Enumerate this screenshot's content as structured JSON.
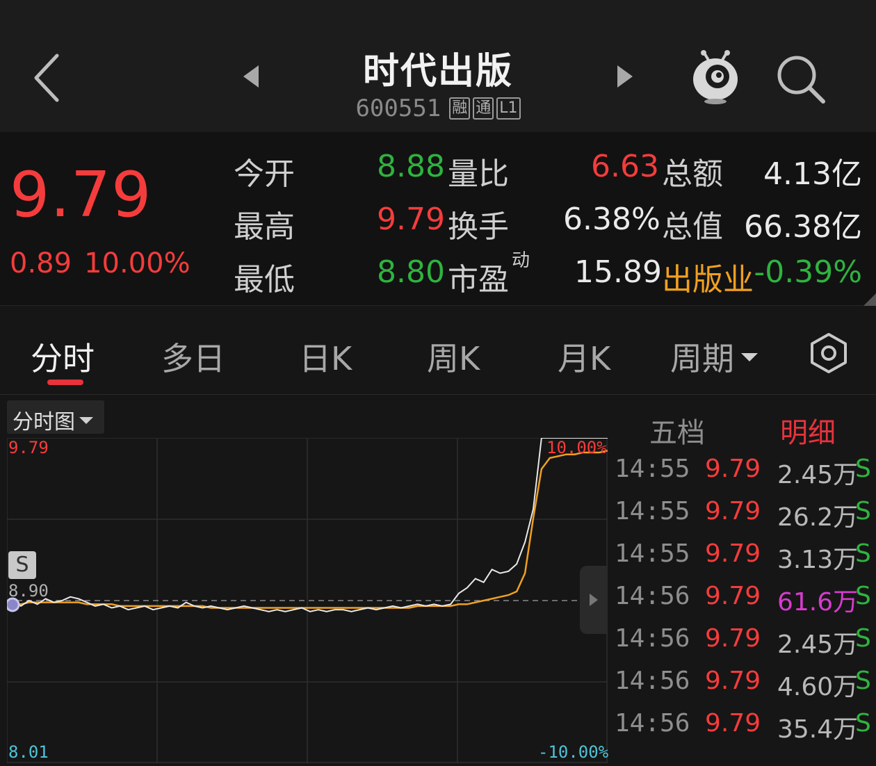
{
  "header": {
    "title": "时代出版",
    "code": "600551",
    "tags": [
      "融",
      "通",
      "L1"
    ]
  },
  "quote": {
    "price": "9.79",
    "change": "0.89",
    "change_pct": "10.00%",
    "rows": [
      {
        "l1": "今开",
        "v1": "8.88",
        "l2": "量比",
        "v2": "6.63",
        "l3": "总额",
        "v3": "4.13亿"
      },
      {
        "l1": "最高",
        "v1": "9.79",
        "l2": "换手",
        "v2": "6.38%",
        "l3": "总值",
        "v3": "66.38亿"
      },
      {
        "l1": "最低",
        "v1": "8.80",
        "l2": "市盈",
        "l2_sup": "动",
        "v2": "15.89",
        "l3": "出版业",
        "v3": "-0.39%"
      }
    ]
  },
  "tabs": [
    "分时",
    "多日",
    "日K",
    "周K",
    "月K",
    "周期"
  ],
  "chart_selector": "分时图",
  "chart_labels": {
    "top_price": "9.79",
    "top_pct": "10.00%",
    "prev_close": "8.90",
    "bottom_price": "8.01",
    "bottom_pct": "-10.00%",
    "s_badge": "S"
  },
  "chart_data": {
    "type": "line",
    "ylim": [
      8.01,
      9.79
    ],
    "prev_close": 8.9,
    "series": [
      {
        "values": [
          8.9,
          8.87,
          8.9,
          8.88,
          8.91,
          8.89,
          8.9,
          8.92,
          8.91,
          8.89,
          8.87,
          8.88,
          8.86,
          8.87,
          8.85,
          8.86,
          8.87,
          8.85,
          8.86,
          8.87,
          8.86,
          8.89,
          8.87,
          8.86,
          8.87,
          8.86,
          8.85,
          8.86,
          8.87,
          8.86,
          8.85,
          8.84,
          8.85,
          8.84,
          8.85,
          8.86,
          8.84,
          8.85,
          8.84,
          8.85,
          8.85,
          8.84,
          8.85,
          8.86,
          8.85,
          8.86,
          8.87,
          8.86,
          8.87,
          8.88,
          8.87,
          8.88,
          8.87,
          8.88,
          8.94,
          8.97,
          9.02,
          9.0,
          9.07,
          9.05,
          9.06,
          9.1,
          9.22,
          9.4,
          9.79,
          9.79,
          9.79,
          9.79,
          9.79,
          9.79,
          9.79,
          9.79,
          9.79
        ]
      },
      {
        "values": [
          8.88,
          8.88,
          8.89,
          8.89,
          8.89,
          8.89,
          8.89,
          8.89,
          8.89,
          8.88,
          8.88,
          8.88,
          8.88,
          8.87,
          8.87,
          8.87,
          8.87,
          8.87,
          8.87,
          8.87,
          8.87,
          8.87,
          8.87,
          8.87,
          8.86,
          8.86,
          8.86,
          8.86,
          8.86,
          8.86,
          8.86,
          8.86,
          8.86,
          8.86,
          8.86,
          8.86,
          8.86,
          8.86,
          8.86,
          8.86,
          8.86,
          8.86,
          8.86,
          8.86,
          8.86,
          8.86,
          8.86,
          8.86,
          8.86,
          8.87,
          8.87,
          8.87,
          8.87,
          8.87,
          8.88,
          8.88,
          8.89,
          8.9,
          8.91,
          8.92,
          8.93,
          8.95,
          9.05,
          9.35,
          9.62,
          9.68,
          9.69,
          9.7,
          9.7,
          9.71,
          9.71,
          9.71,
          9.72
        ]
      }
    ]
  },
  "trades": {
    "header": [
      "五档",
      "明细"
    ],
    "rows": [
      {
        "time": "14:55",
        "price": "9.79",
        "vol": "2.45万",
        "side": "S",
        "big": false
      },
      {
        "time": "14:55",
        "price": "9.79",
        "vol": "26.2万",
        "side": "S",
        "big": false
      },
      {
        "time": "14:55",
        "price": "9.79",
        "vol": "3.13万",
        "side": "S",
        "big": false
      },
      {
        "time": "14:56",
        "price": "9.79",
        "vol": "61.6万",
        "side": "S",
        "big": true
      },
      {
        "time": "14:56",
        "price": "9.79",
        "vol": "2.45万",
        "side": "S",
        "big": false
      },
      {
        "time": "14:56",
        "price": "9.79",
        "vol": "4.60万",
        "side": "S",
        "big": false
      },
      {
        "time": "14:56",
        "price": "9.79",
        "vol": "35.4万",
        "side": "S",
        "big": false
      }
    ]
  },
  "colors": {
    "up": "#f53c3c",
    "down": "#2fb33f",
    "price_line": "#e8e8e8",
    "avg_line": "#f0a020",
    "accent": "#e8323c"
  }
}
